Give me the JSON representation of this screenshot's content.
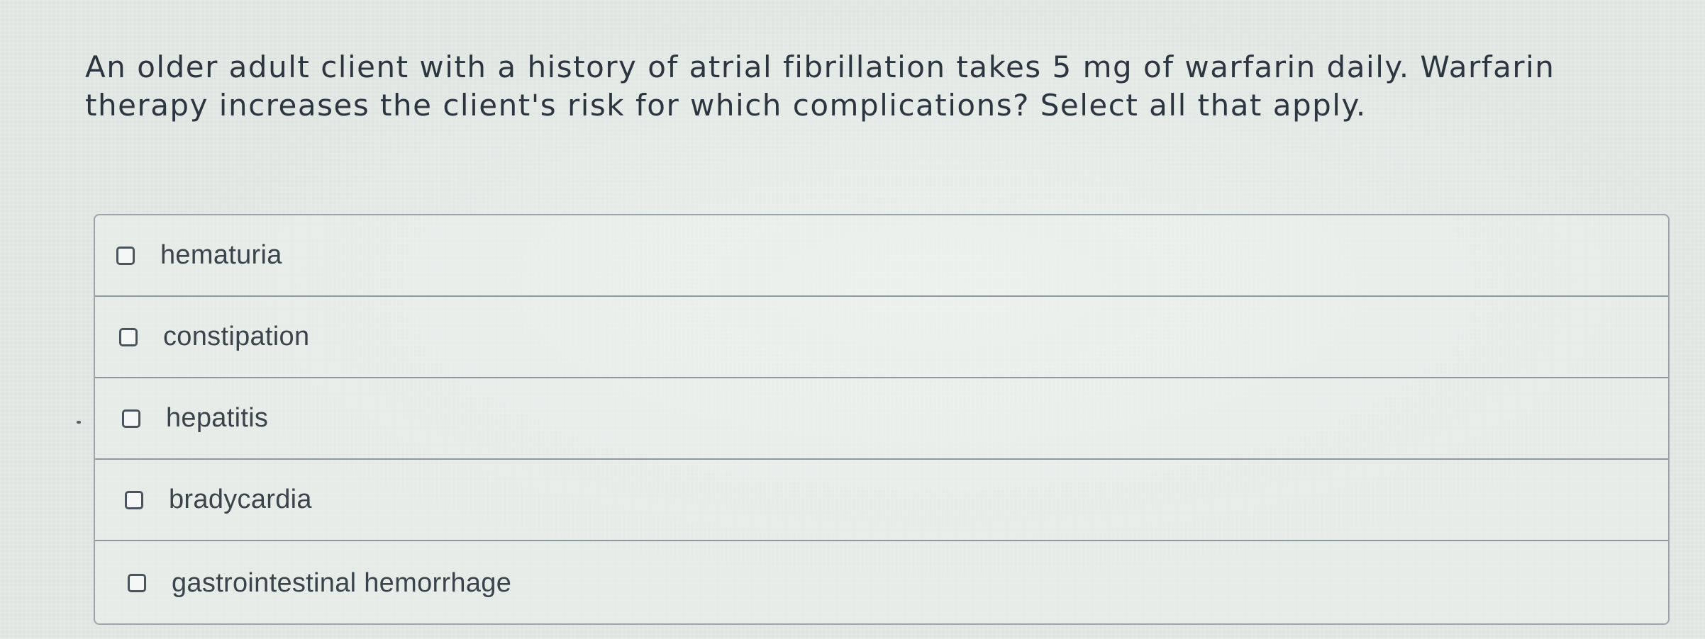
{
  "question": {
    "text": "An older adult client with a history of atrial fibrillation takes 5 mg of warfarin daily. Warfarin therapy increases the client's risk for which complications? Select all that apply."
  },
  "options": [
    {
      "label": "hematuria",
      "checked": false
    },
    {
      "label": "constipation",
      "checked": false
    },
    {
      "label": "hepatitis",
      "checked": false
    },
    {
      "label": "bradycardia",
      "checked": false
    },
    {
      "label": "gastrointestinal hemorrhage",
      "checked": false
    }
  ],
  "colors": {
    "background": "#dfe6e2",
    "text": "#2c3640",
    "border": "#9aa4aa",
    "checkbox_border": "#4a545c"
  }
}
